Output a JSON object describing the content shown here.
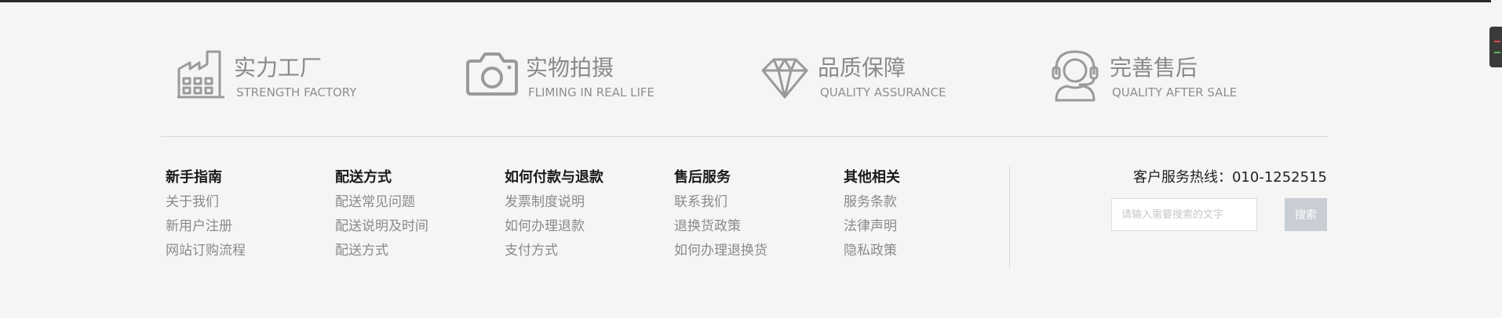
{
  "features": [
    {
      "title": "实力工厂",
      "subtitle": "STRENGTH FACTORY",
      "icon": "factory-icon"
    },
    {
      "title": "实物拍摄",
      "subtitle": "FLIMING IN REAL LIFE",
      "icon": "camera-icon"
    },
    {
      "title": "品质保障",
      "subtitle": "QUALITY ASSURANCE",
      "icon": "diamond-icon"
    },
    {
      "title": "完善售后",
      "subtitle": "QUALITY AFTER SALE",
      "icon": "headset-icon"
    }
  ],
  "columns": [
    {
      "heading": "新手指南",
      "links": [
        "关于我们",
        "新用户注册",
        "网站订购流程"
      ]
    },
    {
      "heading": "配送方式",
      "links": [
        "配送常见问题",
        "配送说明及时间",
        "配送方式"
      ]
    },
    {
      "heading": "如何付款与退款",
      "links": [
        "发票制度说明",
        "如何办理退款",
        "支付方式"
      ]
    },
    {
      "heading": "售后服务",
      "links": [
        "联系我们",
        "退换货政策",
        "如何办理退换货"
      ]
    },
    {
      "heading": "其他相关",
      "links": [
        "服务条款",
        "法律声明",
        "隐私政策"
      ]
    }
  ],
  "service": {
    "hotline_label": "客户服务热线：",
    "hotline_number": "010-1252515"
  },
  "search": {
    "placeholder": "请输入需要搜索的文字",
    "value": "",
    "button_label": "搜索"
  },
  "colors": {
    "background": "#f5f5f5",
    "icon_gray": "#9a9a9a",
    "search_button": "#c9cdd4"
  }
}
